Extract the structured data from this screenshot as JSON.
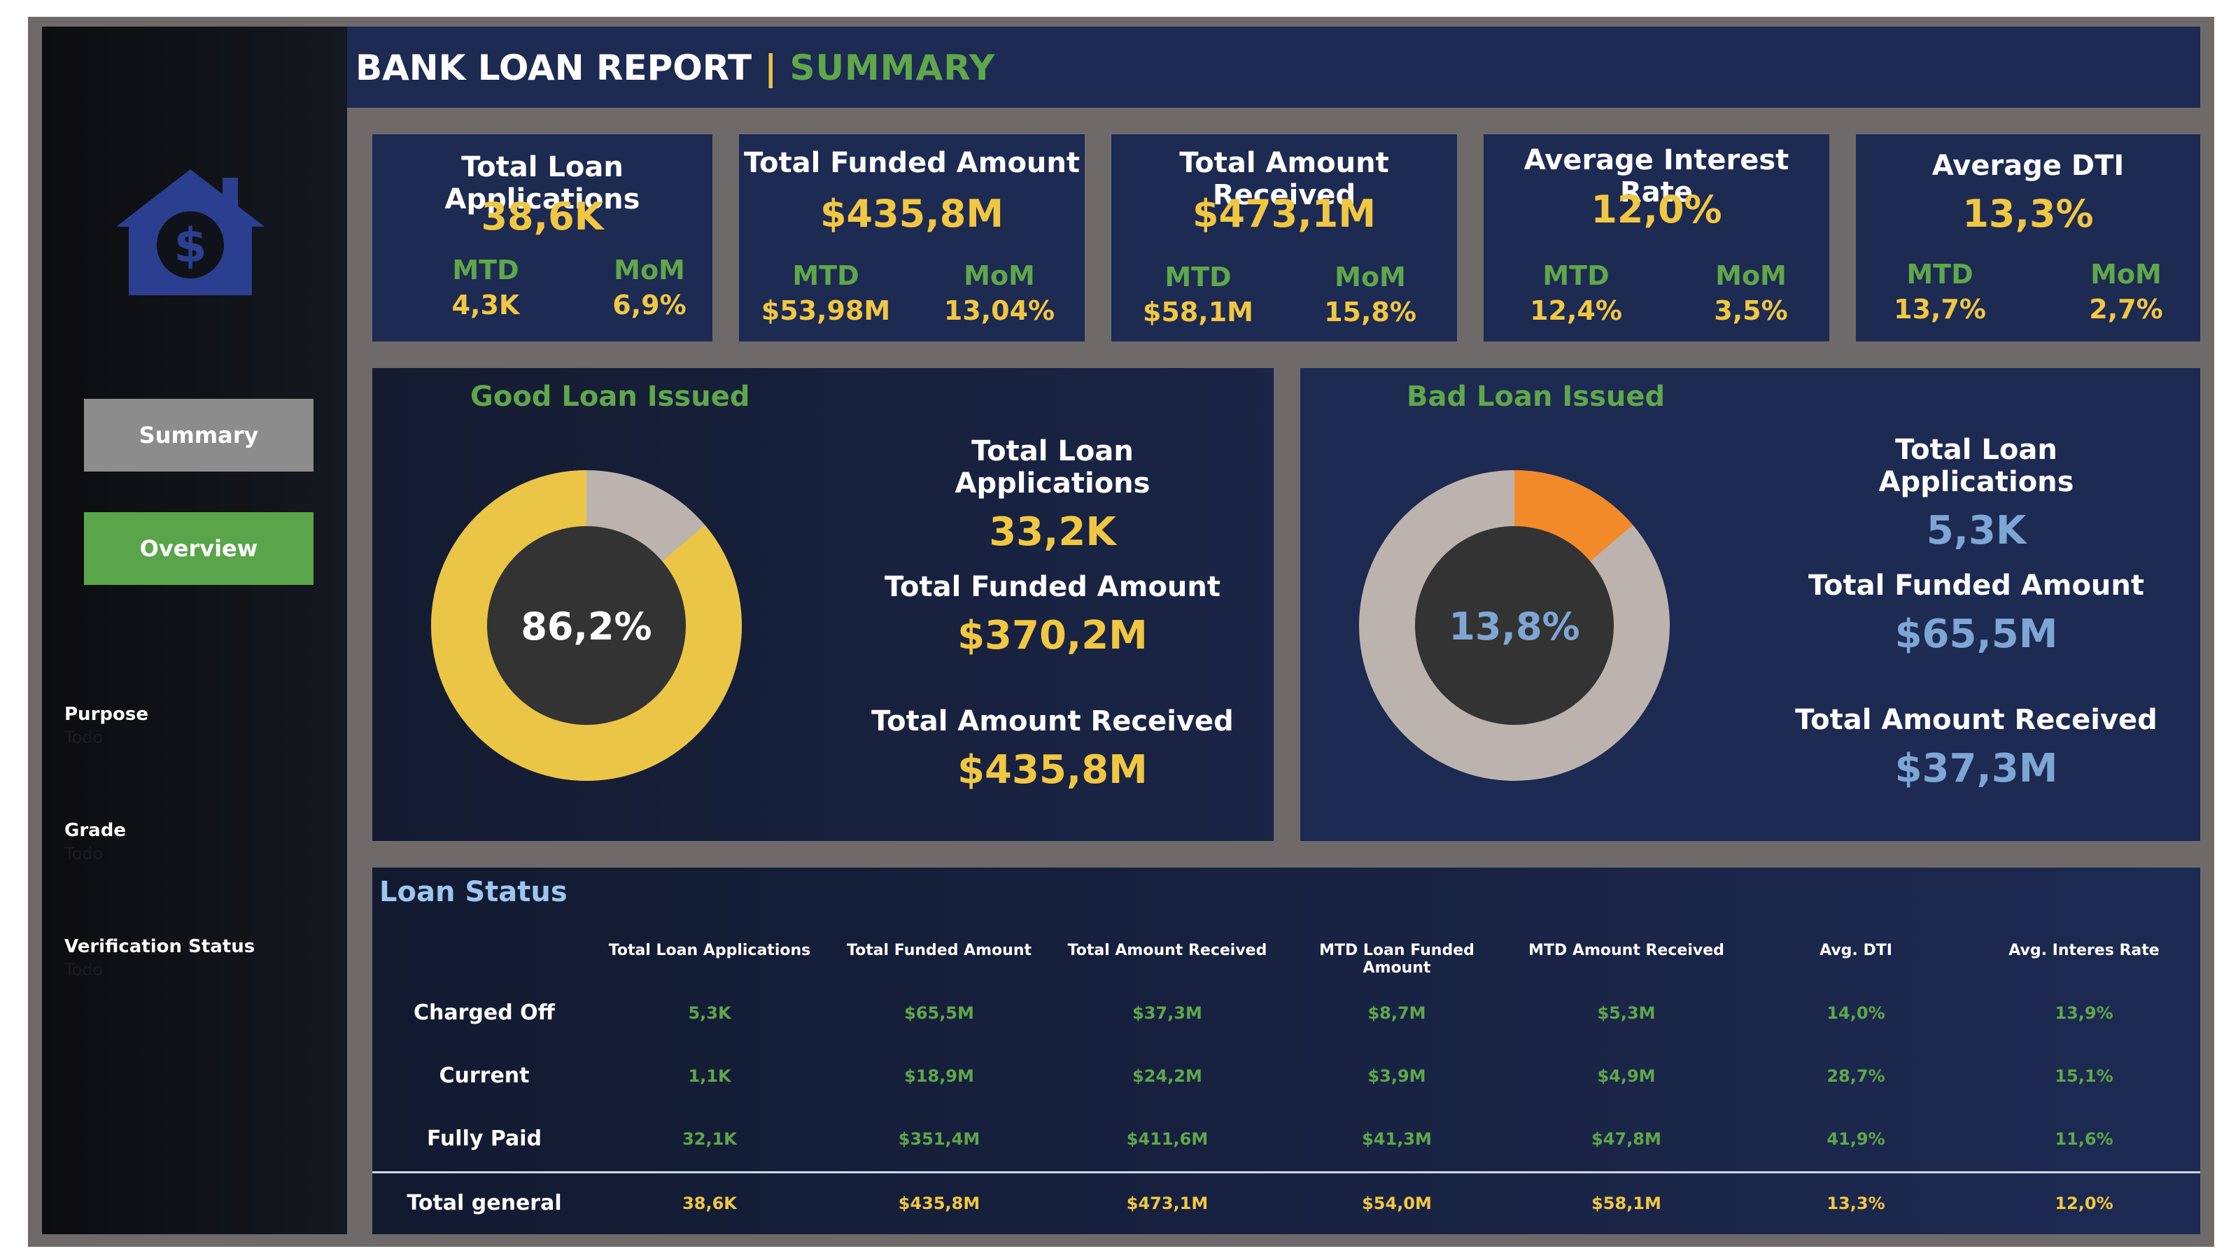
{
  "header": {
    "title": "BANK LOAN REPORT",
    "separator": "|",
    "subtitle": "SUMMARY"
  },
  "sidebar": {
    "logo_icon": "house-dollar-icon",
    "nav": [
      {
        "label": "Summary"
      },
      {
        "label": "Overview"
      }
    ],
    "filters": [
      {
        "label": "Purpose",
        "value": "Todo"
      },
      {
        "label": "Grade",
        "value": "Todo"
      },
      {
        "label": "Verification Status",
        "value": "Todo"
      }
    ]
  },
  "kpis": [
    {
      "title": "Total Loan Applications",
      "value": "38,6K",
      "mtd_label": "MTD",
      "mtd": "4,3K",
      "mom_label": "MoM",
      "mom": "6,9%"
    },
    {
      "title": "Total Funded Amount",
      "value": "$435,8M",
      "mtd_label": "MTD",
      "mtd": "$53,98M",
      "mom_label": "MoM",
      "mom": "13,04%"
    },
    {
      "title": "Total Amount Received",
      "value": "$473,1M",
      "mtd_label": "MTD",
      "mtd": "$58,1M",
      "mom_label": "MoM",
      "mom": "15,8%"
    },
    {
      "title": "Average Interest Rate",
      "value": "12,0%",
      "mtd_label": "MTD",
      "mtd": "12,4%",
      "mom_label": "MoM",
      "mom": "3,5%"
    },
    {
      "title": "Average DTI",
      "value": "13,3%",
      "mtd_label": "MTD",
      "mtd": "13,7%",
      "mom_label": "MoM",
      "mom": "2,7%"
    }
  ],
  "good_loan": {
    "title": "Good Loan Issued",
    "percent_label": "86,2%",
    "percent": 86.2,
    "apps_label": "Total Loan Applications",
    "apps": "33,2K",
    "funded_label": "Total Funded Amount",
    "funded": "$370,2M",
    "received_label": "Total Amount Received",
    "received": "$435,8M",
    "colors": {
      "fill": "#ebc545",
      "rest": "#bcb3ae",
      "hole": "#333333",
      "value": "#f1c742"
    }
  },
  "bad_loan": {
    "title": "Bad Loan Issued",
    "percent_label": "13,8%",
    "percent": 13.8,
    "apps_label": "Total Loan Applications",
    "apps": "5,3K",
    "funded_label": "Total Funded Amount",
    "funded": "$65,5M",
    "received_label": "Total Amount Received",
    "received": "$37,3M",
    "colors": {
      "fill": "#f28a2a",
      "rest": "#bcb3ae",
      "hole": "#333333",
      "value": "#7ea6d4"
    }
  },
  "loan_status": {
    "title": "Loan Status",
    "columns": [
      "Total Loan Applications",
      "Total Funded Amount",
      "Total Amount Received",
      "MTD Loan Funded Amount",
      "MTD Amount Received",
      "Avg. DTI",
      "Avg. Interes Rate"
    ],
    "rows": [
      {
        "label": "Charged Off",
        "cells": [
          "5,3K",
          "$65,5M",
          "$37,3M",
          "$8,7M",
          "$5,3M",
          "14,0%",
          "13,9%"
        ]
      },
      {
        "label": "Current",
        "cells": [
          "1,1K",
          "$18,9M",
          "$24,2M",
          "$3,9M",
          "$4,9M",
          "28,7%",
          "15,1%"
        ]
      },
      {
        "label": "Fully Paid",
        "cells": [
          "32,1K",
          "$351,4M",
          "$411,6M",
          "$41,3M",
          "$47,8M",
          "41,9%",
          "11,6%"
        ]
      }
    ],
    "total": {
      "label": "Total general",
      "cells": [
        "38,6K",
        "$435,8M",
        "$473,1M",
        "$54,0M",
        "$58,1M",
        "13,3%",
        "12,0%"
      ]
    },
    "colors": {
      "row_value": "#5fa74a",
      "total_value": "#f1c742"
    }
  }
}
